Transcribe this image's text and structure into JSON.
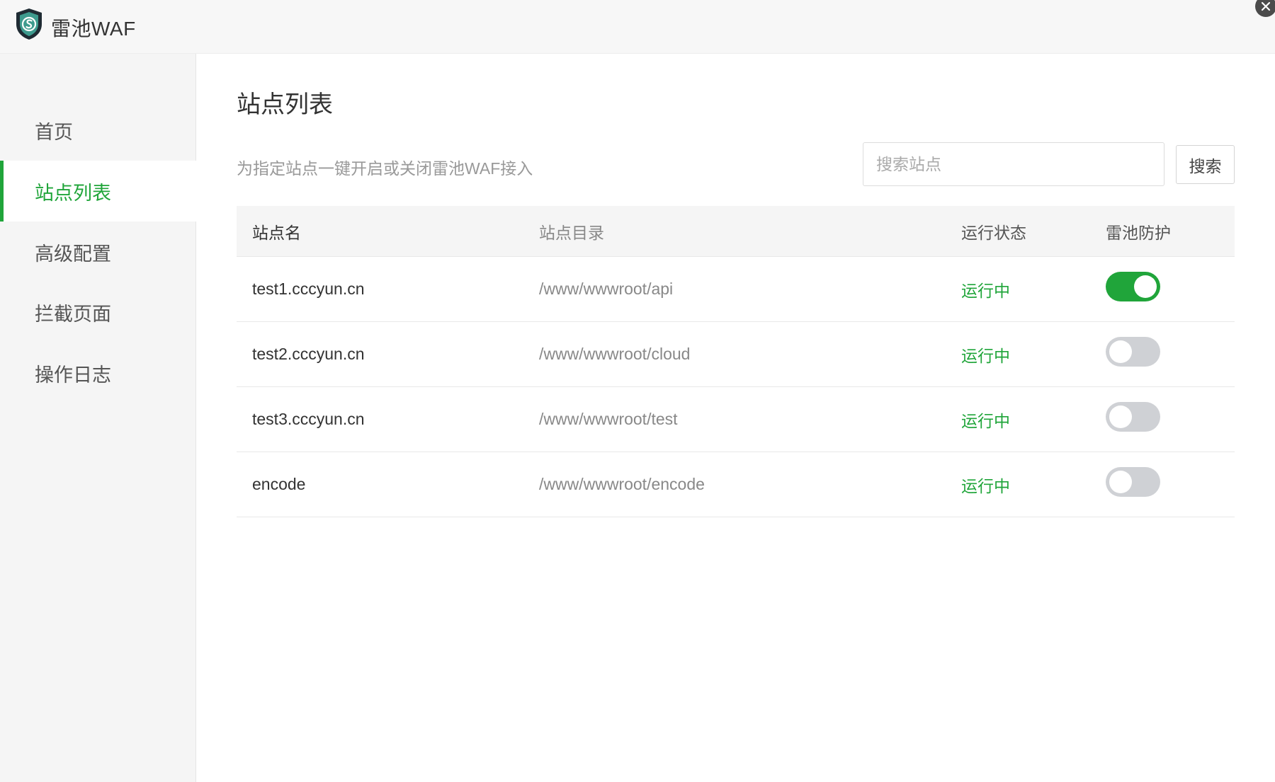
{
  "app": {
    "title": "雷池WAF"
  },
  "colors": {
    "accent": "#20a53a",
    "toggle_off": "#cfd1d5"
  },
  "sidebar": {
    "items": [
      {
        "label": "首页",
        "active": false
      },
      {
        "label": "站点列表",
        "active": true
      },
      {
        "label": "高级配置",
        "active": false
      },
      {
        "label": "拦截页面",
        "active": false
      },
      {
        "label": "操作日志",
        "active": false
      }
    ]
  },
  "main": {
    "title": "站点列表",
    "description": "为指定站点一键开启或关闭雷池WAF接入",
    "search": {
      "placeholder": "搜索站点",
      "value": "",
      "button_label": "搜索"
    },
    "table": {
      "columns": [
        "站点名",
        "站点目录",
        "运行状态",
        "雷池防护"
      ],
      "rows": [
        {
          "name": "test1.cccyun.cn",
          "dir": "/www/wwwroot/api",
          "status": "运行中",
          "protect": true
        },
        {
          "name": "test2.cccyun.cn",
          "dir": "/www/wwwroot/cloud",
          "status": "运行中",
          "protect": false
        },
        {
          "name": "test3.cccyun.cn",
          "dir": "/www/wwwroot/test",
          "status": "运行中",
          "protect": false
        },
        {
          "name": "encode",
          "dir": "/www/wwwroot/encode",
          "status": "运行中",
          "protect": false
        }
      ]
    }
  },
  "icons": {
    "logo": "shield-logo-icon",
    "close": "close-icon"
  }
}
